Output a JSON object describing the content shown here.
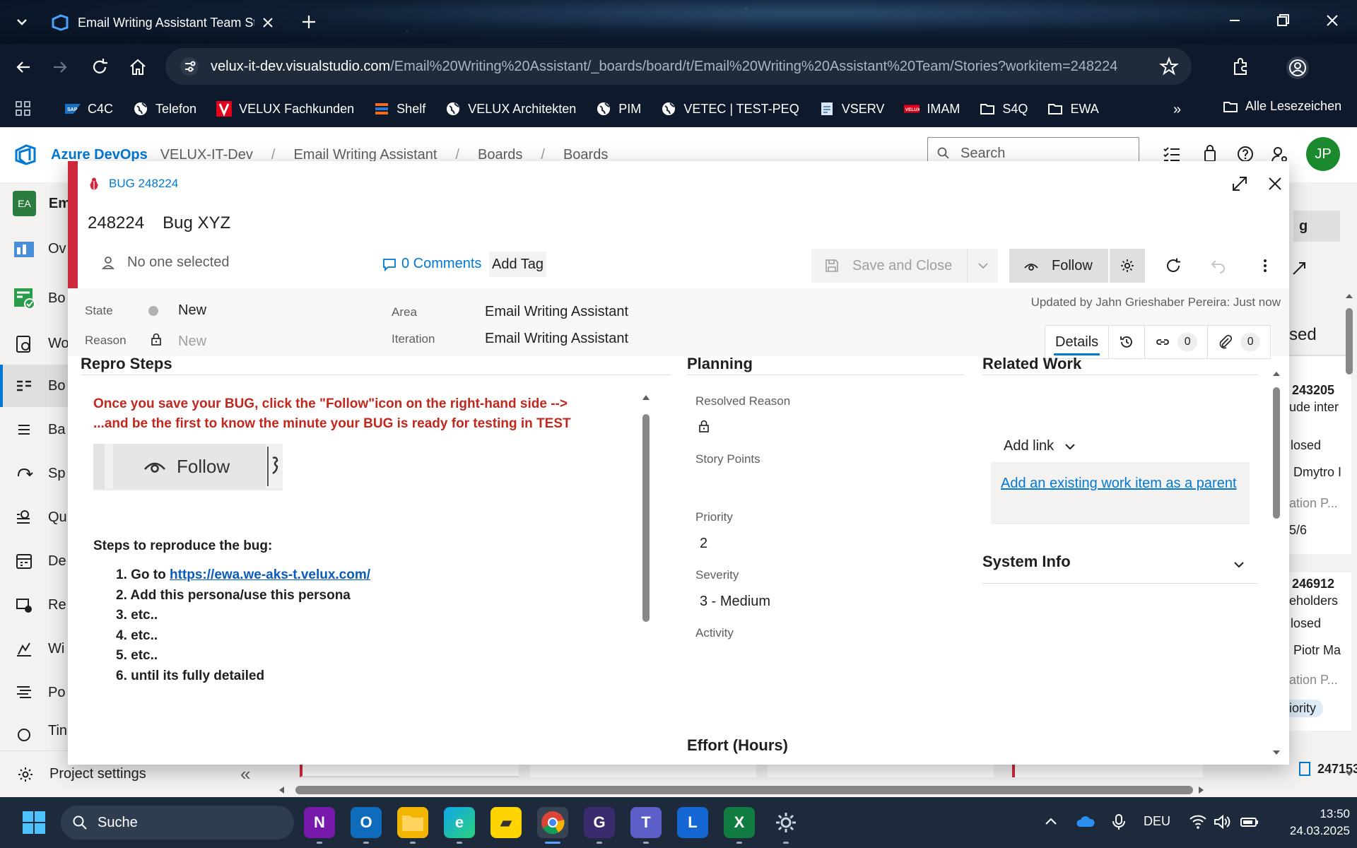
{
  "browser": {
    "tab_title": "Email Writing Assistant Team St",
    "url_domain": "velux-it-dev.visualstudio.com",
    "url_path": "/Email%20Writing%20Assistant/_boards/board/t/Email%20Writing%20Assistant%20Team/Stories?workitem=248224",
    "bookmarks": [
      {
        "label": "C4C",
        "icon": "sap-icon"
      },
      {
        "label": "Telefon",
        "icon": "globe-icon"
      },
      {
        "label": "VELUX Fachkunden",
        "icon": "velux-v-icon"
      },
      {
        "label": "Shelf",
        "icon": "stack-icon"
      },
      {
        "label": "VELUX Architekten",
        "icon": "globe-icon"
      },
      {
        "label": "PIM",
        "icon": "globe-icon"
      },
      {
        "label": "VETEC | TEST-PEQ",
        "icon": "globe-icon"
      },
      {
        "label": "VSERV",
        "icon": "page-icon"
      },
      {
        "label": "IMAM",
        "icon": "velux-badge-icon"
      },
      {
        "label": "S4Q",
        "icon": "folder-icon"
      },
      {
        "label": "EWA",
        "icon": "folder-icon"
      }
    ],
    "all_bookmarks": "Alle Lesezeichen",
    "more": "»"
  },
  "ado": {
    "brand": "Azure DevOps",
    "breadcrumb": [
      "VELUX-IT-Dev",
      "Email Writing Assistant",
      "Boards",
      "Boards"
    ],
    "search_placeholder": "Search",
    "avatar": "JP",
    "sidebar": {
      "project_badge": "EA",
      "project_name": "Em",
      "items": [
        "Ov",
        "Bo",
        "Wo",
        "Bo",
        "Ba",
        "Sp",
        "Qu",
        "De",
        "Re",
        "Wi",
        "Po",
        "Tin"
      ],
      "project_settings": "Project settings",
      "collapse": "«"
    },
    "right_cards": {
      "top_button": "g",
      "header": "sed",
      "c1_id": "243205",
      "c1_title": "ude inter",
      "c1_state": "losed",
      "c1_assignee": "Dmytro I",
      "c1_field": "ation P...",
      "c1_value": "5/6",
      "c2_id": "246912",
      "c2_title": "eholders",
      "c2_state": "losed",
      "c2_assignee": "Piotr Ma",
      "c2_field": "ation P...",
      "c2_tag": "iority",
      "c3_id": "247153"
    }
  },
  "dialog": {
    "type_label": "BUG 248224",
    "id": "248224",
    "title": "Bug XYZ",
    "assigned": "No one selected",
    "comments": "0 Comments",
    "add_tag": "Add Tag",
    "save_close": "Save and Close",
    "follow": "Follow",
    "updated_by": "Updated by Jahn Grieshaber Pereira: Just now",
    "fields": {
      "state_label": "State",
      "state_value": "New",
      "reason_label": "Reason",
      "reason_value": "New",
      "area_label": "Area",
      "area_value": "Email Writing Assistant",
      "iteration_label": "Iteration",
      "iteration_value": "Email Writing Assistant"
    },
    "tabs": {
      "details": "Details",
      "links_count": "0",
      "attachments_count": "0"
    },
    "repro": {
      "title": "Repro Steps",
      "line1": "Once you save your BUG, click the \"Follow\"icon on the right-hand side -->",
      "line2": "...and be the first to know the minute your BUG is ready for testing in TEST",
      "follow_sample": "Follow",
      "steps_heading": "Steps to reproduce the bug:",
      "step1_prefix": "1. Go to ",
      "step1_link": "https://ewa.we-aks-t.velux.com/",
      "step2": "2. Add this persona/use this persona",
      "step3": "3. etc..",
      "step4": "4. etc..",
      "step5": "5. etc..",
      "step6": "6. until its fully detailed"
    },
    "planning": {
      "title": "Planning",
      "resolved_reason_label": "Resolved Reason",
      "story_points_label": "Story Points",
      "priority_label": "Priority",
      "priority_value": "2",
      "severity_label": "Severity",
      "severity_value": "3 - Medium",
      "activity_label": "Activity",
      "effort_title": "Effort (Hours)"
    },
    "related": {
      "title": "Related Work",
      "add_link": "Add link",
      "parent_link": "Add an existing work item as a parent",
      "system_info": "System Info"
    }
  },
  "taskbar": {
    "search": "Suche",
    "language": "DEU",
    "time": "13:50",
    "date": "24.03.2025"
  }
}
